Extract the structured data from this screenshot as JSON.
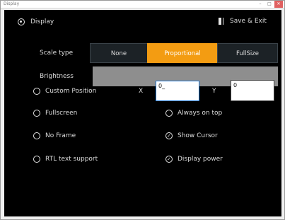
{
  "window": {
    "title": "Display",
    "controls": [
      "–",
      "□",
      "✕"
    ]
  },
  "header": {
    "section_title": "Display",
    "save_exit_label": "Save & Exit"
  },
  "scale": {
    "label": "Scale type",
    "options": [
      "None",
      "Proportional",
      "FullSize"
    ],
    "selected": "Proportional"
  },
  "brightness": {
    "label": "Brightness"
  },
  "custom_position": {
    "label": "Custom Position",
    "x_label": "X",
    "x_value": "0_",
    "y_label": "Y",
    "y_value": "0"
  },
  "options": {
    "fullscreen": {
      "label": "Fullscreen",
      "checked": false
    },
    "always_on_top": {
      "label": "Always on top",
      "checked": false
    },
    "no_frame": {
      "label": "No Frame",
      "checked": false
    },
    "show_cursor": {
      "label": "Show Cursor",
      "checked": true
    },
    "rtl_text_support": {
      "label": "RTL text support",
      "checked": false
    },
    "display_power": {
      "label": "Display power",
      "checked": true
    }
  },
  "colors": {
    "accent": "#f39c12",
    "background": "#000000",
    "text": "#dcdcdc"
  }
}
